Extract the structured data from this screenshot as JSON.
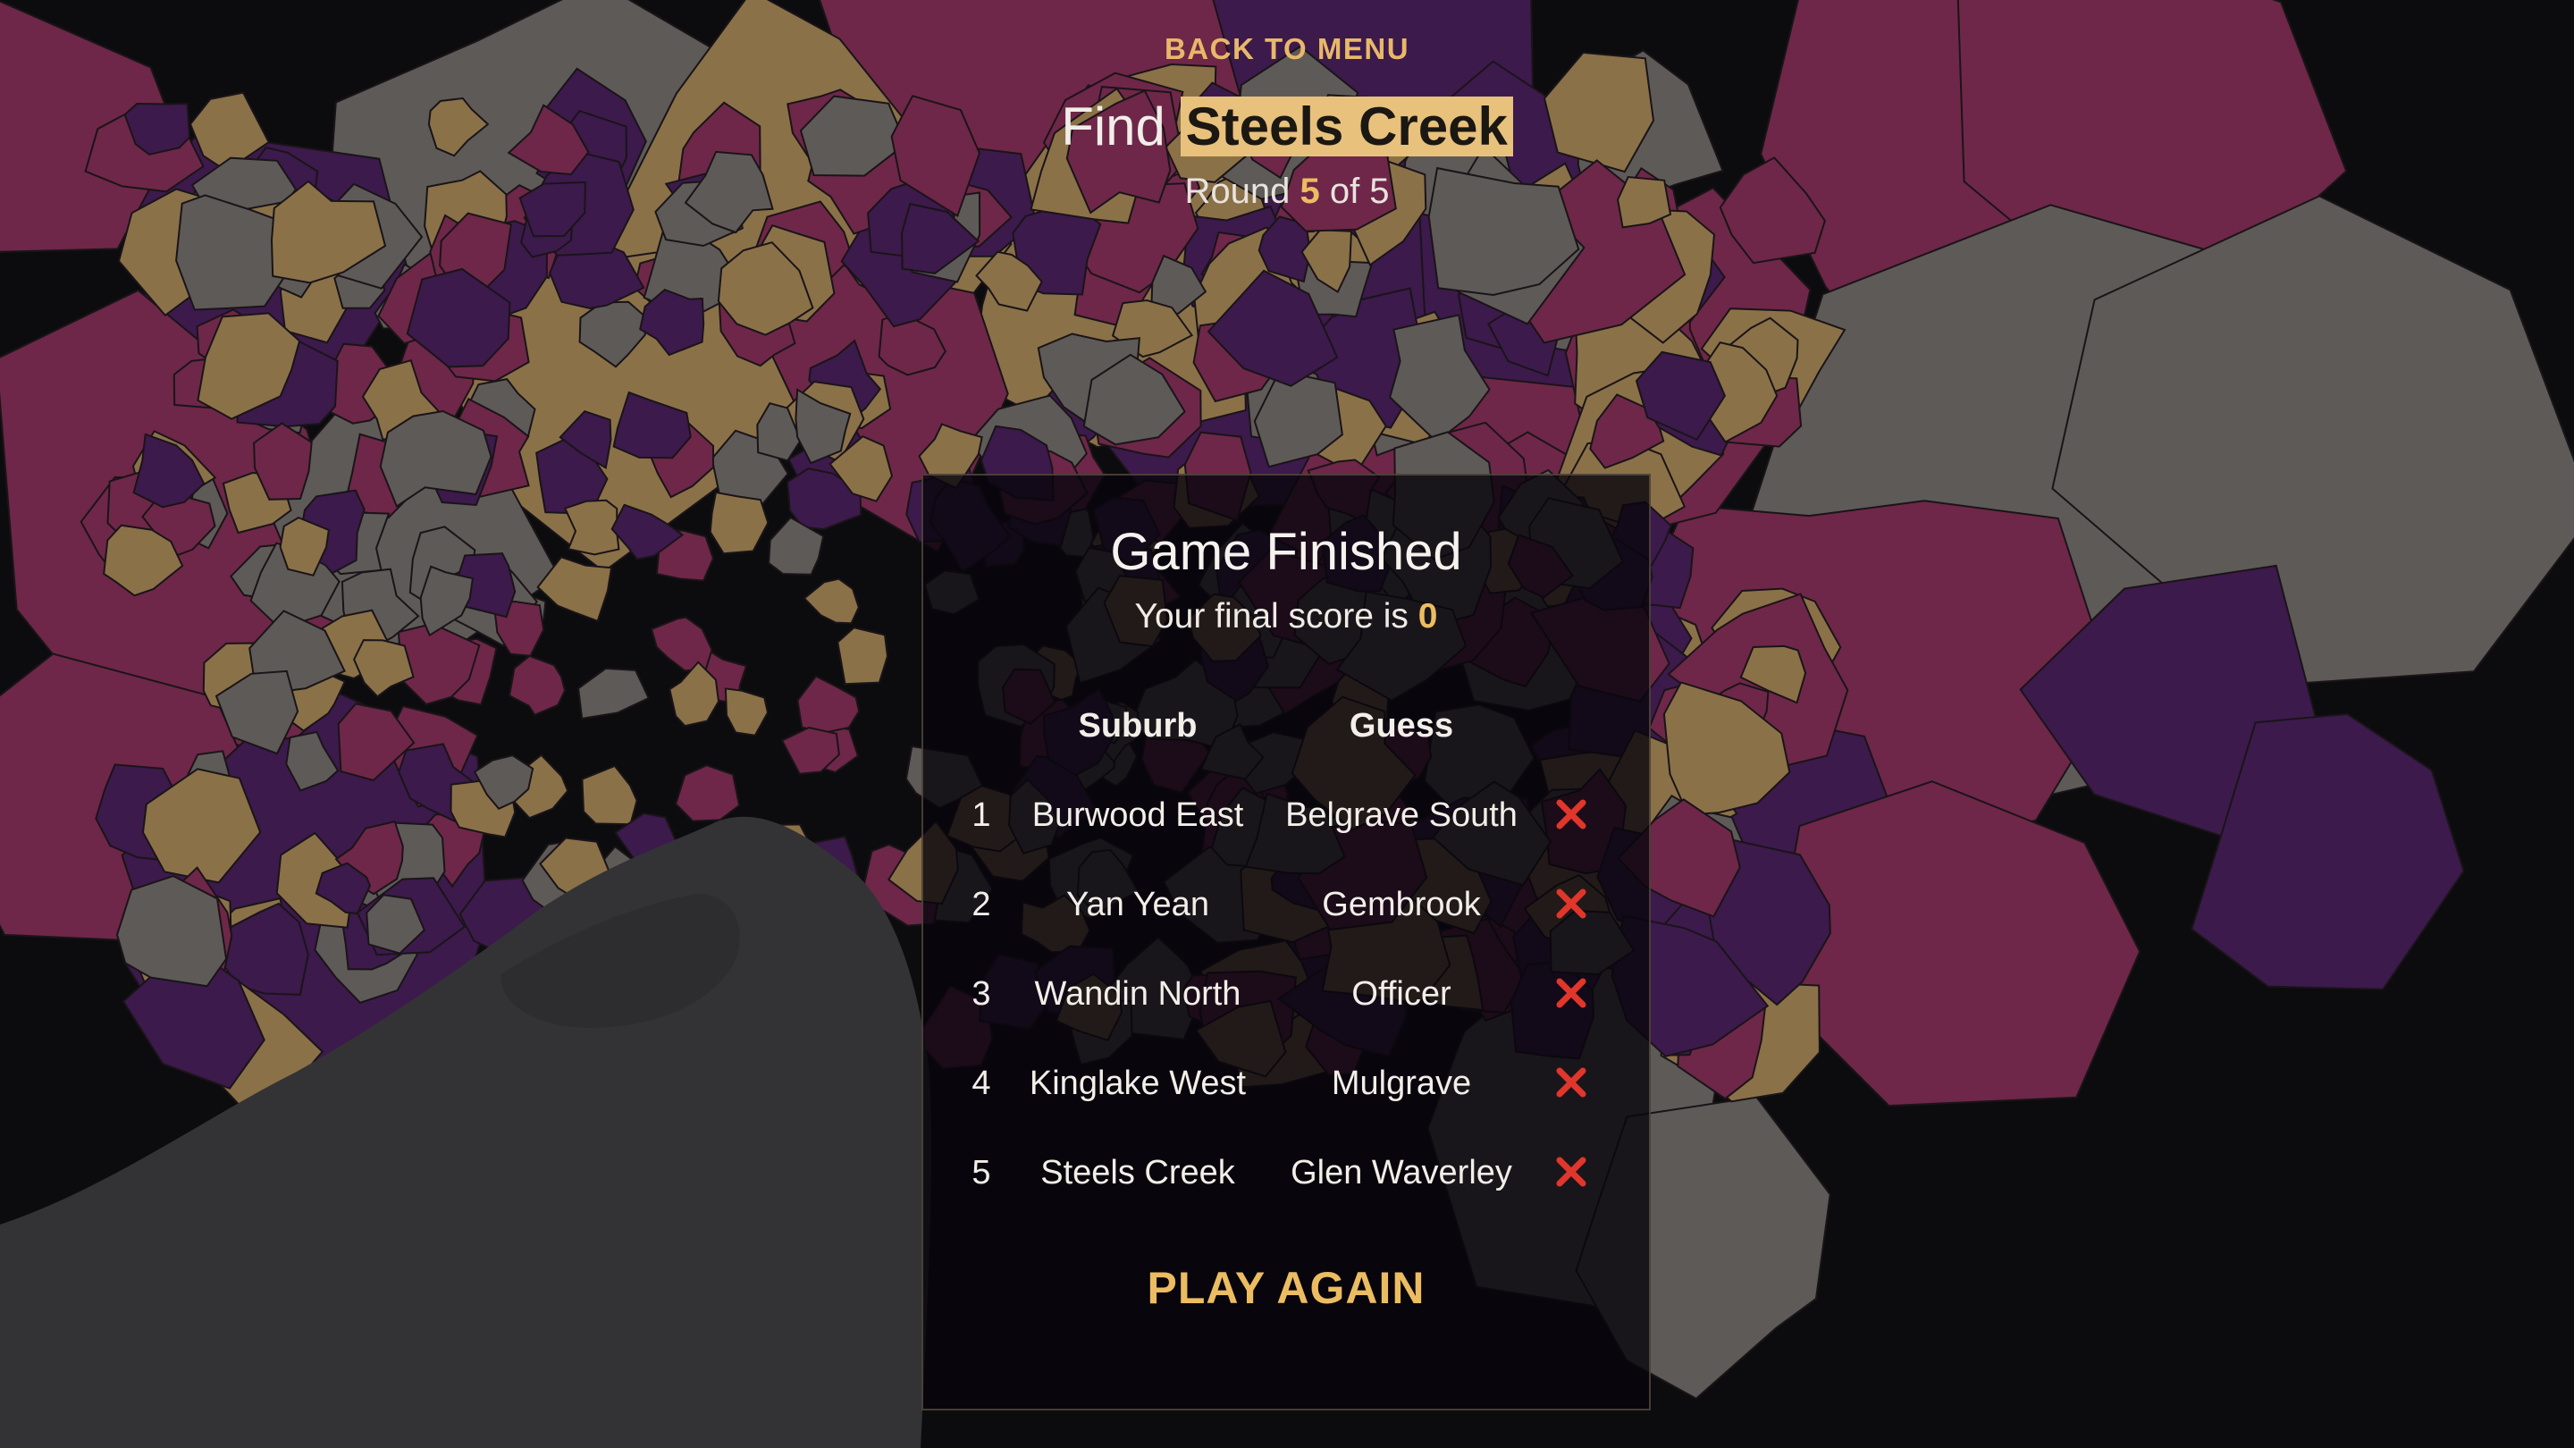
{
  "header": {
    "back_label": "BACK TO MENU",
    "find_prefix": "Find",
    "target_suburb": "Steels Creek",
    "round_prefix": "Round",
    "round_current": "5",
    "round_of": "of 5"
  },
  "result": {
    "title": "Game Finished",
    "score_prefix": "Your final score is",
    "score": "0",
    "columns": [
      "Suburb",
      "Guess"
    ],
    "rows": [
      {
        "n": "1",
        "suburb": "Burwood East",
        "guess": "Belgrave South",
        "correct": false
      },
      {
        "n": "2",
        "suburb": "Yan Yean",
        "guess": "Gembrook",
        "correct": false
      },
      {
        "n": "3",
        "suburb": "Wandin North",
        "guess": "Officer",
        "correct": false
      },
      {
        "n": "4",
        "suburb": "Kinglake West",
        "guess": "Mulgrave",
        "correct": false
      },
      {
        "n": "5",
        "suburb": "Steels Creek",
        "guess": "Glen Waverley",
        "correct": false
      }
    ],
    "play_again_label": "PLAY AGAIN"
  },
  "colors": {
    "accent": "#ecbc62",
    "wrong": "#e0362b",
    "region_gold": "#8a7148",
    "region_magenta": "#6e2748",
    "region_purple": "#3c1a4c",
    "region_grey": "#5e5a57",
    "bay": "#333336"
  }
}
